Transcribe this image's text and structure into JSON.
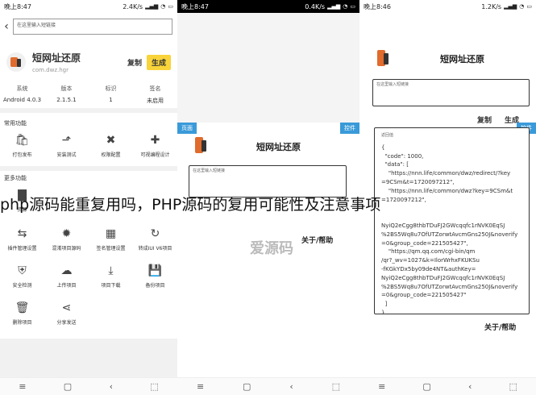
{
  "panel1": {
    "status": {
      "time": "晚上8:47",
      "speed": "2.4K/s"
    },
    "url_label": "在这里输入短链接",
    "app_name": "短网址还原",
    "app_pkg": "com.dwz.hgr",
    "copy_label": "复制",
    "generate_label": "生成",
    "stats": [
      {
        "label": "系统",
        "value": "Android 4.0.3"
      },
      {
        "label": "版本",
        "value": "2.1.5.1"
      },
      {
        "label": "标识",
        "value": "1"
      },
      {
        "label": "签名",
        "value": "未启用"
      }
    ],
    "common_title": "常用功能",
    "common_items": [
      {
        "label": "打包发布",
        "icon": "🛍"
      },
      {
        "label": "安装测试",
        "icon": "⬏"
      },
      {
        "label": "权限配置",
        "icon": "✖"
      },
      {
        "label": "可视编程设计",
        "icon": "✚"
      }
    ],
    "more_title": "更多功能",
    "more_items_row1": [
      {
        "label": "资源",
        "icon": "▇"
      },
      {
        "label": "",
        "icon": ""
      },
      {
        "label": "",
        "icon": ""
      },
      {
        "label": "",
        "icon": ""
      }
    ],
    "more_items_row2": [
      {
        "label": "插件管理设置",
        "icon": "⇆"
      },
      {
        "label": "混淆项目源码",
        "icon": "✹"
      },
      {
        "label": "签名管理设置",
        "icon": "▦"
      },
      {
        "label": "转成IUI V6项目",
        "icon": "↻"
      }
    ],
    "more_items_row3": [
      {
        "label": "安全检测",
        "icon": "⛨"
      },
      {
        "label": "上传项目",
        "icon": "☁"
      },
      {
        "label": "项目下载",
        "icon": "⤓"
      },
      {
        "label": "备份项目",
        "icon": "💾"
      }
    ],
    "more_items_row4": [
      {
        "label": "删除项目",
        "icon": "🗑"
      },
      {
        "label": "分享发送",
        "icon": "⋖"
      },
      {
        "label": "",
        "icon": ""
      },
      {
        "label": "",
        "icon": ""
      }
    ]
  },
  "panel2": {
    "status": {
      "time": "晚上8:47",
      "speed": "0.4K/s"
    },
    "tag_left": "页面",
    "tag_right": "控件",
    "title": "短网址还原",
    "url_label": "在这里输入短链接",
    "help_label": "关于/帮助",
    "watermark": "爱源码"
  },
  "panel3": {
    "status": {
      "time": "晚上8:46",
      "speed": "1.2K/s"
    },
    "title": "短网址还原",
    "url_label": "在这里输入短链接",
    "copy_label": "复制",
    "generate_label": "生成",
    "result_label": "返回值",
    "tag_right": "控件",
    "json_lines": [
      "{",
      "  \"code\": 1000,",
      "  \"data\": [",
      "    \"https://nnn.life/common/dwz/redirect/?key",
      "=9CSm&t=1720097212\",",
      "    \"https://nnn.life/common/dwz?key=9CSm&t",
      "=1720097212\",",
      "",
      "",
      "NyiQ2eCgg8thbTDuFJ2GWcqqfc1rNVK0EqSJ",
      "%2BS5Wq8u7OfUTZorwtAvcmGns250J&noverify",
      "=0&group_code=221505427\",",
      "    \"https://qm.qq.com/cgi-bin/qm",
      "/qr?_wv=1027&k=IlorWrhxFKUKSu",
      "-fKGkYDx5by09de4NT&authKey=",
      "NyiQ2eCgg8thbTDuFJ2GWcqqfc1rNVK0EqSJ",
      "%2BS5Wq8u7OfUTZorwtAvcmGns250J&noverify",
      "=0&group_code=221505427\"",
      "  ]",
      "}"
    ],
    "help_label": "关于/帮助"
  },
  "caption": "php源码能重复用吗，PHP源码的复用可能性及注意事项",
  "nav": {
    "menu": "≡",
    "home": "▢",
    "back": "‹",
    "toggle": "⬚"
  }
}
